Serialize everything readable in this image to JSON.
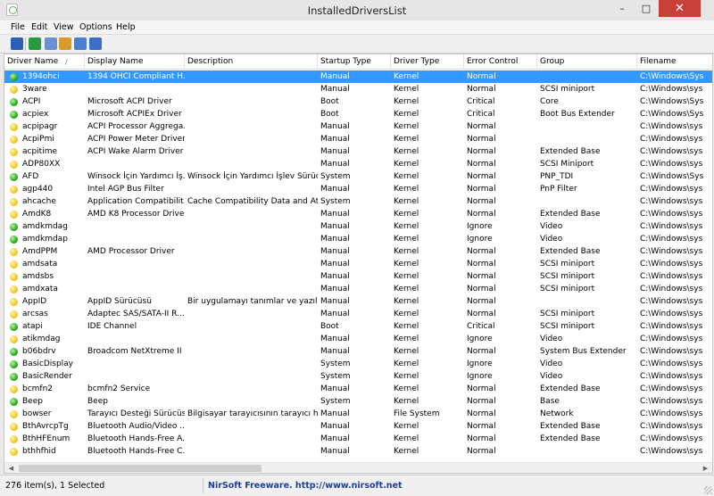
{
  "window": {
    "title": "InstalledDriversList",
    "minimize_glyph": "–",
    "maximize_glyph": "□",
    "close_glyph": "✕"
  },
  "menu": [
    "File",
    "Edit",
    "View",
    "Options",
    "Help"
  ],
  "toolbar": {
    "buttons": [
      {
        "icon": "save-icon",
        "color": "#2d5fb5"
      },
      {
        "icon": "refresh-icon",
        "color": "#2a9a3e"
      },
      {
        "icon": "copy-icon",
        "color": "#6b8fd6"
      },
      {
        "icon": "properties-icon",
        "color": "#d99b2b"
      },
      {
        "icon": "html-report-icon",
        "color": "#4a7fd0"
      },
      {
        "icon": "exit-icon",
        "color": "#3b6ec9"
      }
    ]
  },
  "columns": [
    "Driver Name",
    "Display Name",
    "Description",
    "Startup Type",
    "Driver Type",
    "Error Control",
    "Group",
    "Filename"
  ],
  "sort_indicator": "/",
  "rows": [
    {
      "status": "green",
      "cells": [
        "1394ohci",
        "1394 OHCI Compliant H...",
        "",
        "Manual",
        "Kernel",
        "Normal",
        "",
        "C:\\Windows\\Sys"
      ],
      "selected": true
    },
    {
      "status": "yellow",
      "cells": [
        "3ware",
        "",
        "",
        "Manual",
        "Kernel",
        "Normal",
        "SCSI miniport",
        "C:\\Windows\\sys"
      ]
    },
    {
      "status": "green",
      "cells": [
        "ACPI",
        "Microsoft ACPI Driver",
        "",
        "Boot",
        "Kernel",
        "Critical",
        "Core",
        "C:\\Windows\\Sys"
      ]
    },
    {
      "status": "green",
      "cells": [
        "acpiex",
        "Microsoft ACPIEx Driver",
        "",
        "Boot",
        "Kernel",
        "Critical",
        "Boot Bus Extender",
        "C:\\Windows\\Sys"
      ]
    },
    {
      "status": "yellow",
      "cells": [
        "acpipagr",
        "ACPI Processor Aggrega...",
        "",
        "Manual",
        "Kernel",
        "Normal",
        "",
        "C:\\Windows\\sys"
      ]
    },
    {
      "status": "yellow",
      "cells": [
        "AcpiPmi",
        "ACPI Power Meter Driver",
        "",
        "Manual",
        "Kernel",
        "Normal",
        "",
        "C:\\Windows\\sys"
      ]
    },
    {
      "status": "yellow",
      "cells": [
        "acpitime",
        "ACPI Wake Alarm Driver",
        "",
        "Manual",
        "Kernel",
        "Normal",
        "Extended Base",
        "C:\\Windows\\sys"
      ]
    },
    {
      "status": "yellow",
      "cells": [
        "ADP80XX",
        "",
        "",
        "Manual",
        "Kernel",
        "Normal",
        "SCSI Miniport",
        "C:\\Windows\\sys"
      ]
    },
    {
      "status": "green",
      "cells": [
        "AFD",
        "Winsock İçin Yardımcı İş...",
        "Winsock İçin Yardımcı İşlev Sürücü...",
        "System",
        "Kernel",
        "Normal",
        "PNP_TDI",
        "C:\\Windows\\Sys"
      ]
    },
    {
      "status": "yellow",
      "cells": [
        "agp440",
        "Intel AGP Bus Filter",
        "",
        "Manual",
        "Kernel",
        "Normal",
        "PnP Filter",
        "C:\\Windows\\sys"
      ]
    },
    {
      "status": "yellow",
      "cells": [
        "ahcache",
        "Application Compatibilit...",
        "Cache Compatibility Data and Att...",
        "System",
        "Kernel",
        "Normal",
        "",
        "C:\\Windows\\sys"
      ]
    },
    {
      "status": "yellow",
      "cells": [
        "AmdK8",
        "AMD K8 Processor Driver",
        "",
        "Manual",
        "Kernel",
        "Normal",
        "Extended Base",
        "C:\\Windows\\sys"
      ]
    },
    {
      "status": "green",
      "cells": [
        "amdkmdag",
        "",
        "",
        "Manual",
        "Kernel",
        "Ignore",
        "Video",
        "C:\\Windows\\sys"
      ]
    },
    {
      "status": "green",
      "cells": [
        "amdkmdap",
        "",
        "",
        "Manual",
        "Kernel",
        "Ignore",
        "Video",
        "C:\\Windows\\sys"
      ]
    },
    {
      "status": "yellow",
      "cells": [
        "AmdPPM",
        "AMD Processor Driver",
        "",
        "Manual",
        "Kernel",
        "Normal",
        "Extended Base",
        "C:\\Windows\\sys"
      ]
    },
    {
      "status": "yellow",
      "cells": [
        "amdsata",
        "",
        "",
        "Manual",
        "Kernel",
        "Normal",
        "SCSI miniport",
        "C:\\Windows\\sys"
      ]
    },
    {
      "status": "yellow",
      "cells": [
        "amdsbs",
        "",
        "",
        "Manual",
        "Kernel",
        "Normal",
        "SCSI miniport",
        "C:\\Windows\\sys"
      ]
    },
    {
      "status": "yellow",
      "cells": [
        "amdxata",
        "",
        "",
        "Manual",
        "Kernel",
        "Normal",
        "SCSI miniport",
        "C:\\Windows\\sys"
      ]
    },
    {
      "status": "yellow",
      "cells": [
        "AppID",
        "AppID Sürücüsü",
        "Bir uygulamayı tanımlar ve yazılı...",
        "Manual",
        "Kernel",
        "Normal",
        "",
        "C:\\Windows\\sys"
      ]
    },
    {
      "status": "yellow",
      "cells": [
        "arcsas",
        "Adaptec SAS/SATA-II R...",
        "",
        "Manual",
        "Kernel",
        "Normal",
        "SCSI miniport",
        "C:\\Windows\\sys"
      ]
    },
    {
      "status": "green",
      "cells": [
        "atapi",
        "IDE Channel",
        "",
        "Boot",
        "Kernel",
        "Critical",
        "SCSI miniport",
        "C:\\Windows\\sys"
      ]
    },
    {
      "status": "yellow",
      "cells": [
        "atikmdag",
        "",
        "",
        "Manual",
        "Kernel",
        "Ignore",
        "Video",
        "C:\\Windows\\sys"
      ]
    },
    {
      "status": "green",
      "cells": [
        "b06bdrv",
        "Broadcom NetXtreme II ...",
        "",
        "Manual",
        "Kernel",
        "Normal",
        "System Bus Extender",
        "C:\\Windows\\sys"
      ]
    },
    {
      "status": "green",
      "cells": [
        "BasicDisplay",
        "",
        "",
        "System",
        "Kernel",
        "Ignore",
        "Video",
        "C:\\Windows\\sys"
      ]
    },
    {
      "status": "green",
      "cells": [
        "BasicRender",
        "",
        "",
        "System",
        "Kernel",
        "Ignore",
        "Video",
        "C:\\Windows\\sys"
      ]
    },
    {
      "status": "yellow",
      "cells": [
        "bcmfn2",
        "bcmfn2 Service",
        "",
        "Manual",
        "Kernel",
        "Normal",
        "Extended Base",
        "C:\\Windows\\sys"
      ]
    },
    {
      "status": "green",
      "cells": [
        "Beep",
        "Beep",
        "",
        "System",
        "Kernel",
        "Normal",
        "Base",
        "C:\\Windows\\sys"
      ]
    },
    {
      "status": "yellow",
      "cells": [
        "bowser",
        "Tarayıcı Desteği Sürücüsü",
        "Bilgisayar tarayıcısının tarayıcı hiz...",
        "Manual",
        "File System",
        "Normal",
        "Network",
        "C:\\Windows\\sys"
      ]
    },
    {
      "status": "yellow",
      "cells": [
        "BthAvrcpTg",
        "Bluetooth Audio/Video ...",
        "",
        "Manual",
        "Kernel",
        "Normal",
        "Extended Base",
        "C:\\Windows\\sys"
      ]
    },
    {
      "status": "yellow",
      "cells": [
        "BthHFEnum",
        "Bluetooth Hands-Free A...",
        "",
        "Manual",
        "Kernel",
        "Normal",
        "Extended Base",
        "C:\\Windows\\sys"
      ]
    },
    {
      "status": "yellow",
      "cells": [
        "bthhfhid",
        "Bluetooth Hands-Free C...",
        "",
        "Manual",
        "Kernel",
        "Normal",
        "",
        "C:\\Windows\\sys"
      ]
    }
  ],
  "scrollbar": {
    "left_glyph": "◀",
    "right_glyph": "▶"
  },
  "status": {
    "count": "276 item(s), 1 Selected",
    "link": "NirSoft Freeware.  http://www.nirsoft.net"
  }
}
